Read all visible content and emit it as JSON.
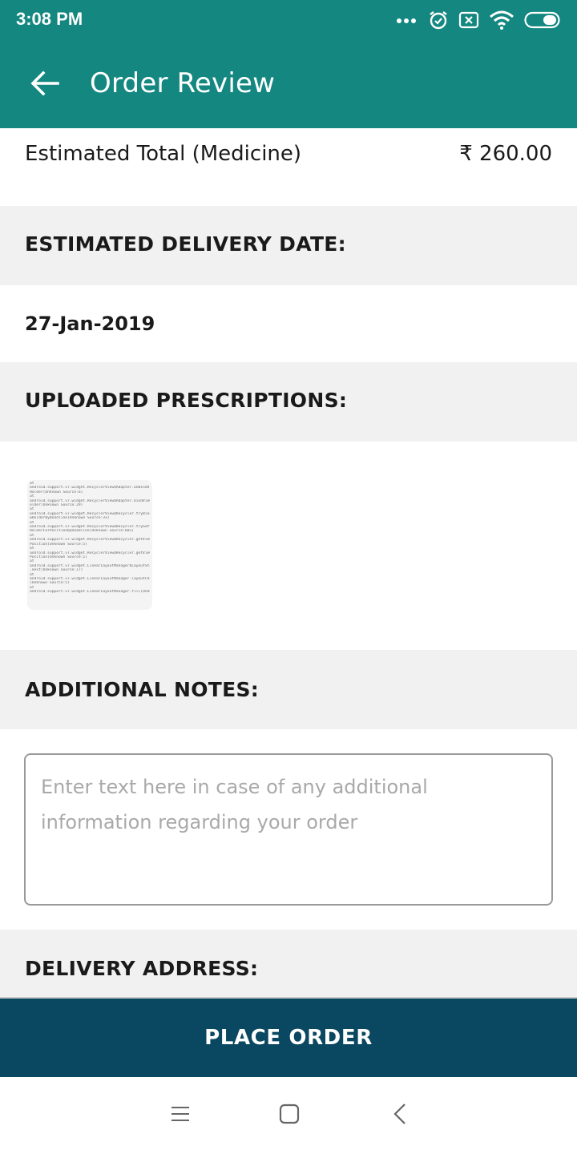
{
  "status_bar": {
    "time": "3:08 PM",
    "icons": [
      "more-dots-icon",
      "alarm-icon",
      "sim-disabled-icon",
      "wifi-icon",
      "battery-icon"
    ]
  },
  "app_bar": {
    "title": "Order Review",
    "back_icon": "arrow-left-icon"
  },
  "order_total": {
    "label": "Estimated Total (Medicine)",
    "value": "₹ 260.00"
  },
  "sections": {
    "delivery_date_header": "ESTIMATED DELIVERY DATE:",
    "prescriptions_header": "UPLOADED PRESCRIPTIONS:",
    "notes_header": "ADDITIONAL NOTES:",
    "address_header": "DELIVERY ADDRESS:"
  },
  "delivery_date": "27-Jan-2019",
  "prescription_thumbnail_lines": [
    "at",
    "android.support.v7.widget.RecyclerView$Adapter.onBindView",
    "Holder(Unknown Source:6)",
    "at",
    "android.support.v7.widget.RecyclerView$Adapter.bindViewH",
    "older(Unknown Source:29)",
    "at",
    "android.support.v7.widget.RecyclerView$Recycler.tryBindVie",
    "wHolderByDeadline(Unknown Source:33)",
    "at",
    "android.support.v7.widget.RecyclerView$Recycler.tryGetView",
    "HolderForPositionByDeadline(Unknown Source:601)",
    "at",
    "android.support.v7.widget.RecyclerView$Recycler.getViewFor",
    "Position(Unknown Source:5)",
    "at",
    "android.support.v7.widget.RecyclerView$Recycler.getViewFor",
    "Position(Unknown Source:1)",
    "at",
    "android.support.v7.widget.LinearLayoutManager$LayoutState",
    ".next(Unknown Source:17)",
    "at",
    "android.support.v7.widget.LinearLayoutManager.layoutChunk",
    "(Unknown Source:5)",
    "at",
    "android.support.v7.widget.LinearLayoutManager.fill(Unknown"
  ],
  "notes": {
    "placeholder": "Enter text here in case of any additional information regarding your order",
    "value": ""
  },
  "place_order_label": "PLACE ORDER",
  "nav_bar": {
    "icons": [
      "menu-icon",
      "home-square-icon",
      "back-chevron-icon"
    ]
  },
  "colors": {
    "app_bar": "#138780",
    "section_bg": "#f1f1f1",
    "place_order_bg": "#0a4760"
  }
}
